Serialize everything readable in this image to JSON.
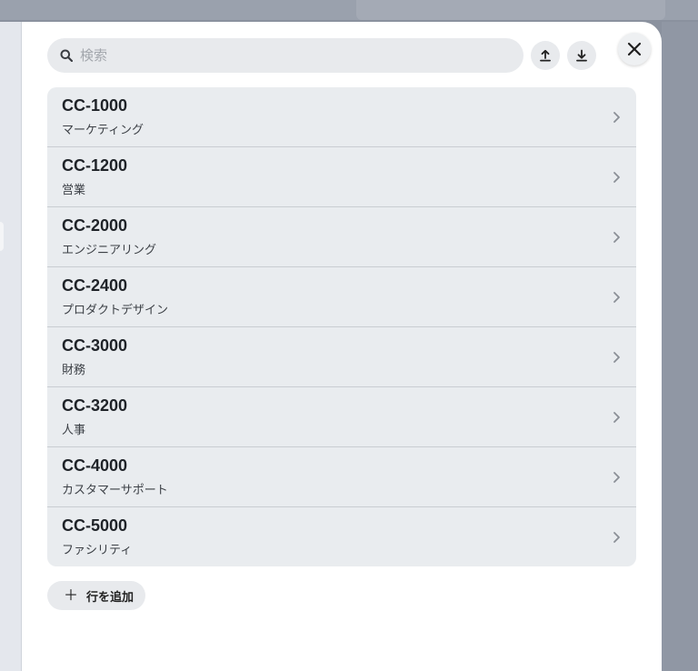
{
  "search": {
    "placeholder": "検索",
    "value": ""
  },
  "actions": {
    "upload_icon": "upload-icon",
    "download_icon": "download-icon",
    "close_icon": "close-icon"
  },
  "rows": [
    {
      "code": "CC-1000",
      "name": "マーケティング"
    },
    {
      "code": "CC-1200",
      "name": "営業"
    },
    {
      "code": "CC-2000",
      "name": "エンジニアリング"
    },
    {
      "code": "CC-2400",
      "name": "プロダクトデザイン"
    },
    {
      "code": "CC-3000",
      "name": "財務"
    },
    {
      "code": "CC-3200",
      "name": "人事"
    },
    {
      "code": "CC-4000",
      "name": "カスタマーサポート"
    },
    {
      "code": "CC-5000",
      "name": "ファシリティ"
    }
  ],
  "add_row": {
    "label": "行を追加",
    "icon": "plus-icon"
  },
  "colors": {
    "panel_bg": "#ffffff",
    "list_bg": "#e9ecef",
    "button_bg": "#e8eaed",
    "text_primary": "#1f2328"
  }
}
